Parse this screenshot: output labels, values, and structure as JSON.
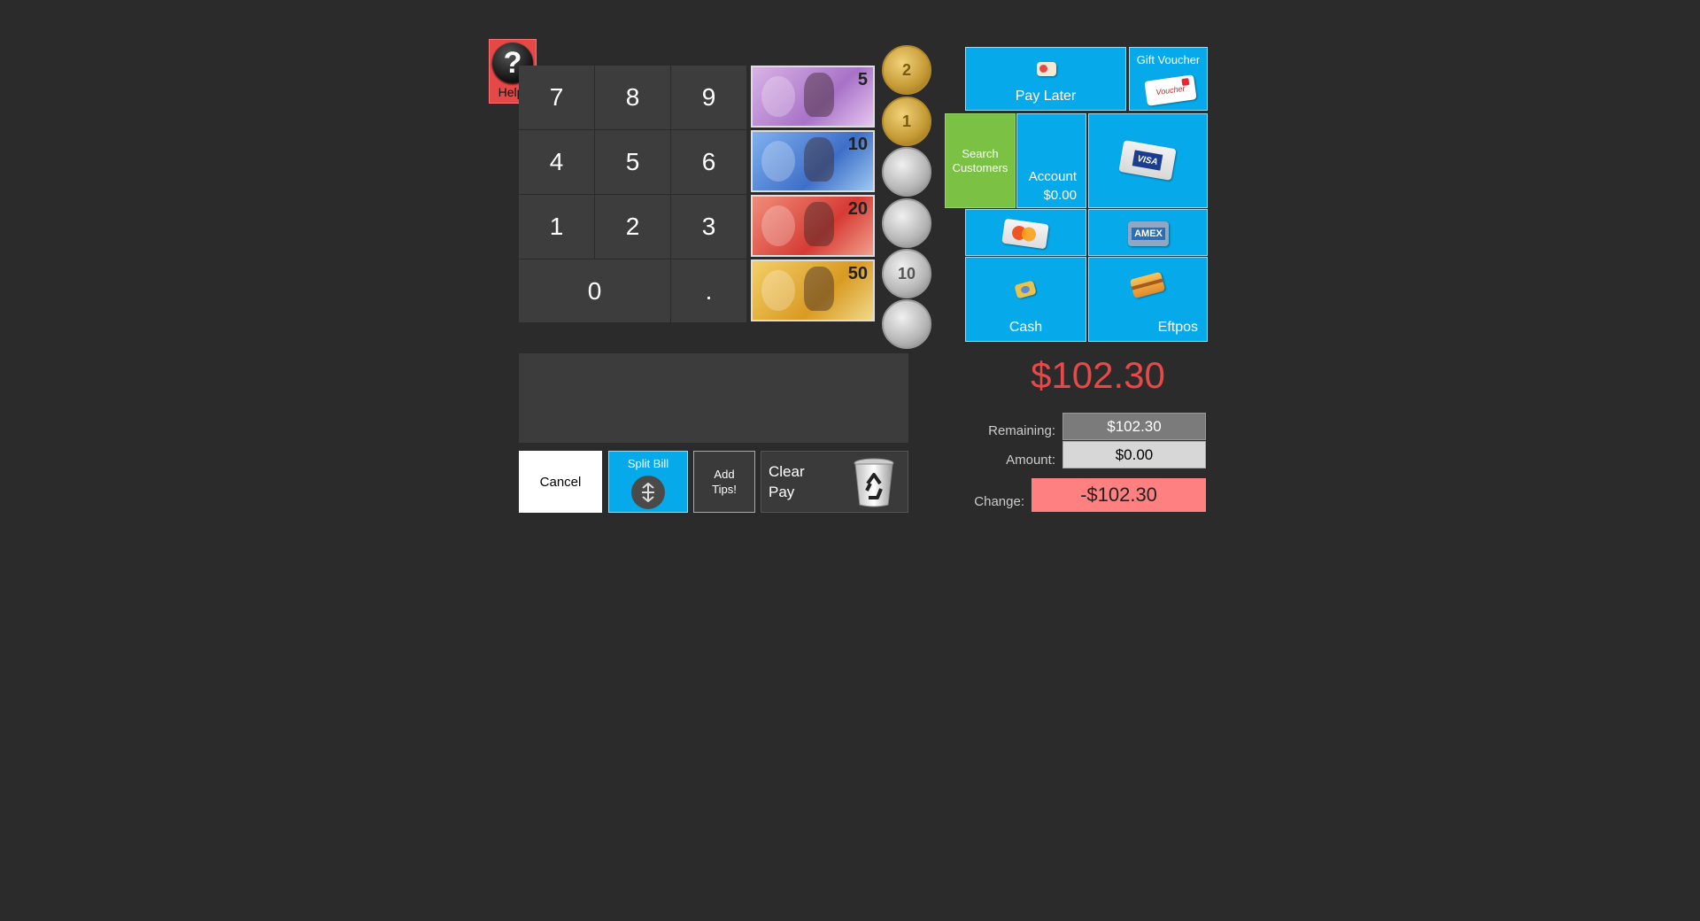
{
  "help": {
    "icon": "?",
    "label": "Help!"
  },
  "keypad": {
    "keys": [
      "7",
      "8",
      "9",
      "4",
      "5",
      "6",
      "1",
      "2",
      "3",
      "0",
      "."
    ]
  },
  "notes": [
    {
      "value": "5",
      "color": "#c79ad8"
    },
    {
      "value": "10",
      "color": "#4f86d6"
    },
    {
      "value": "20",
      "color": "#e65a4a"
    },
    {
      "value": "50",
      "color": "#e2b43a"
    }
  ],
  "coins": [
    {
      "label": "2",
      "metal": "gold"
    },
    {
      "label": "1",
      "metal": "gold"
    },
    {
      "label": "",
      "metal": "silver"
    },
    {
      "label": "",
      "metal": "silver"
    },
    {
      "label": "10",
      "metal": "silver"
    },
    {
      "label": "",
      "metal": "silver"
    }
  ],
  "payments": {
    "pay_later": "Pay Later",
    "gift_voucher": "Gift Voucher",
    "voucher_text": "Voucher",
    "search_customers": "Search Customers",
    "account": "Account",
    "account_balance": "$0.00",
    "visa": "VISA",
    "mastercard": "MasterCard",
    "amex": "AMEX",
    "cash": "Cash",
    "eftpos": "Eftpos"
  },
  "actions": {
    "cancel": "Cancel",
    "split_bill": "Split Bill",
    "add_tips_line1": "Add",
    "add_tips_line2": "Tips!",
    "clear_pay_line1": "Clear",
    "clear_pay_line2": "Pay"
  },
  "totals": {
    "total": "$102.30",
    "remaining_label": "Remaining:",
    "remaining_value": "$102.30",
    "amount_label": "Amount:",
    "amount_value": "$0.00",
    "change_label": "Change:",
    "change_value": "-$102.30"
  },
  "colors": {
    "accent": "#06a9e9",
    "green": "#7bc144",
    "danger": "#e84848",
    "change_bg": "#ff8080"
  }
}
